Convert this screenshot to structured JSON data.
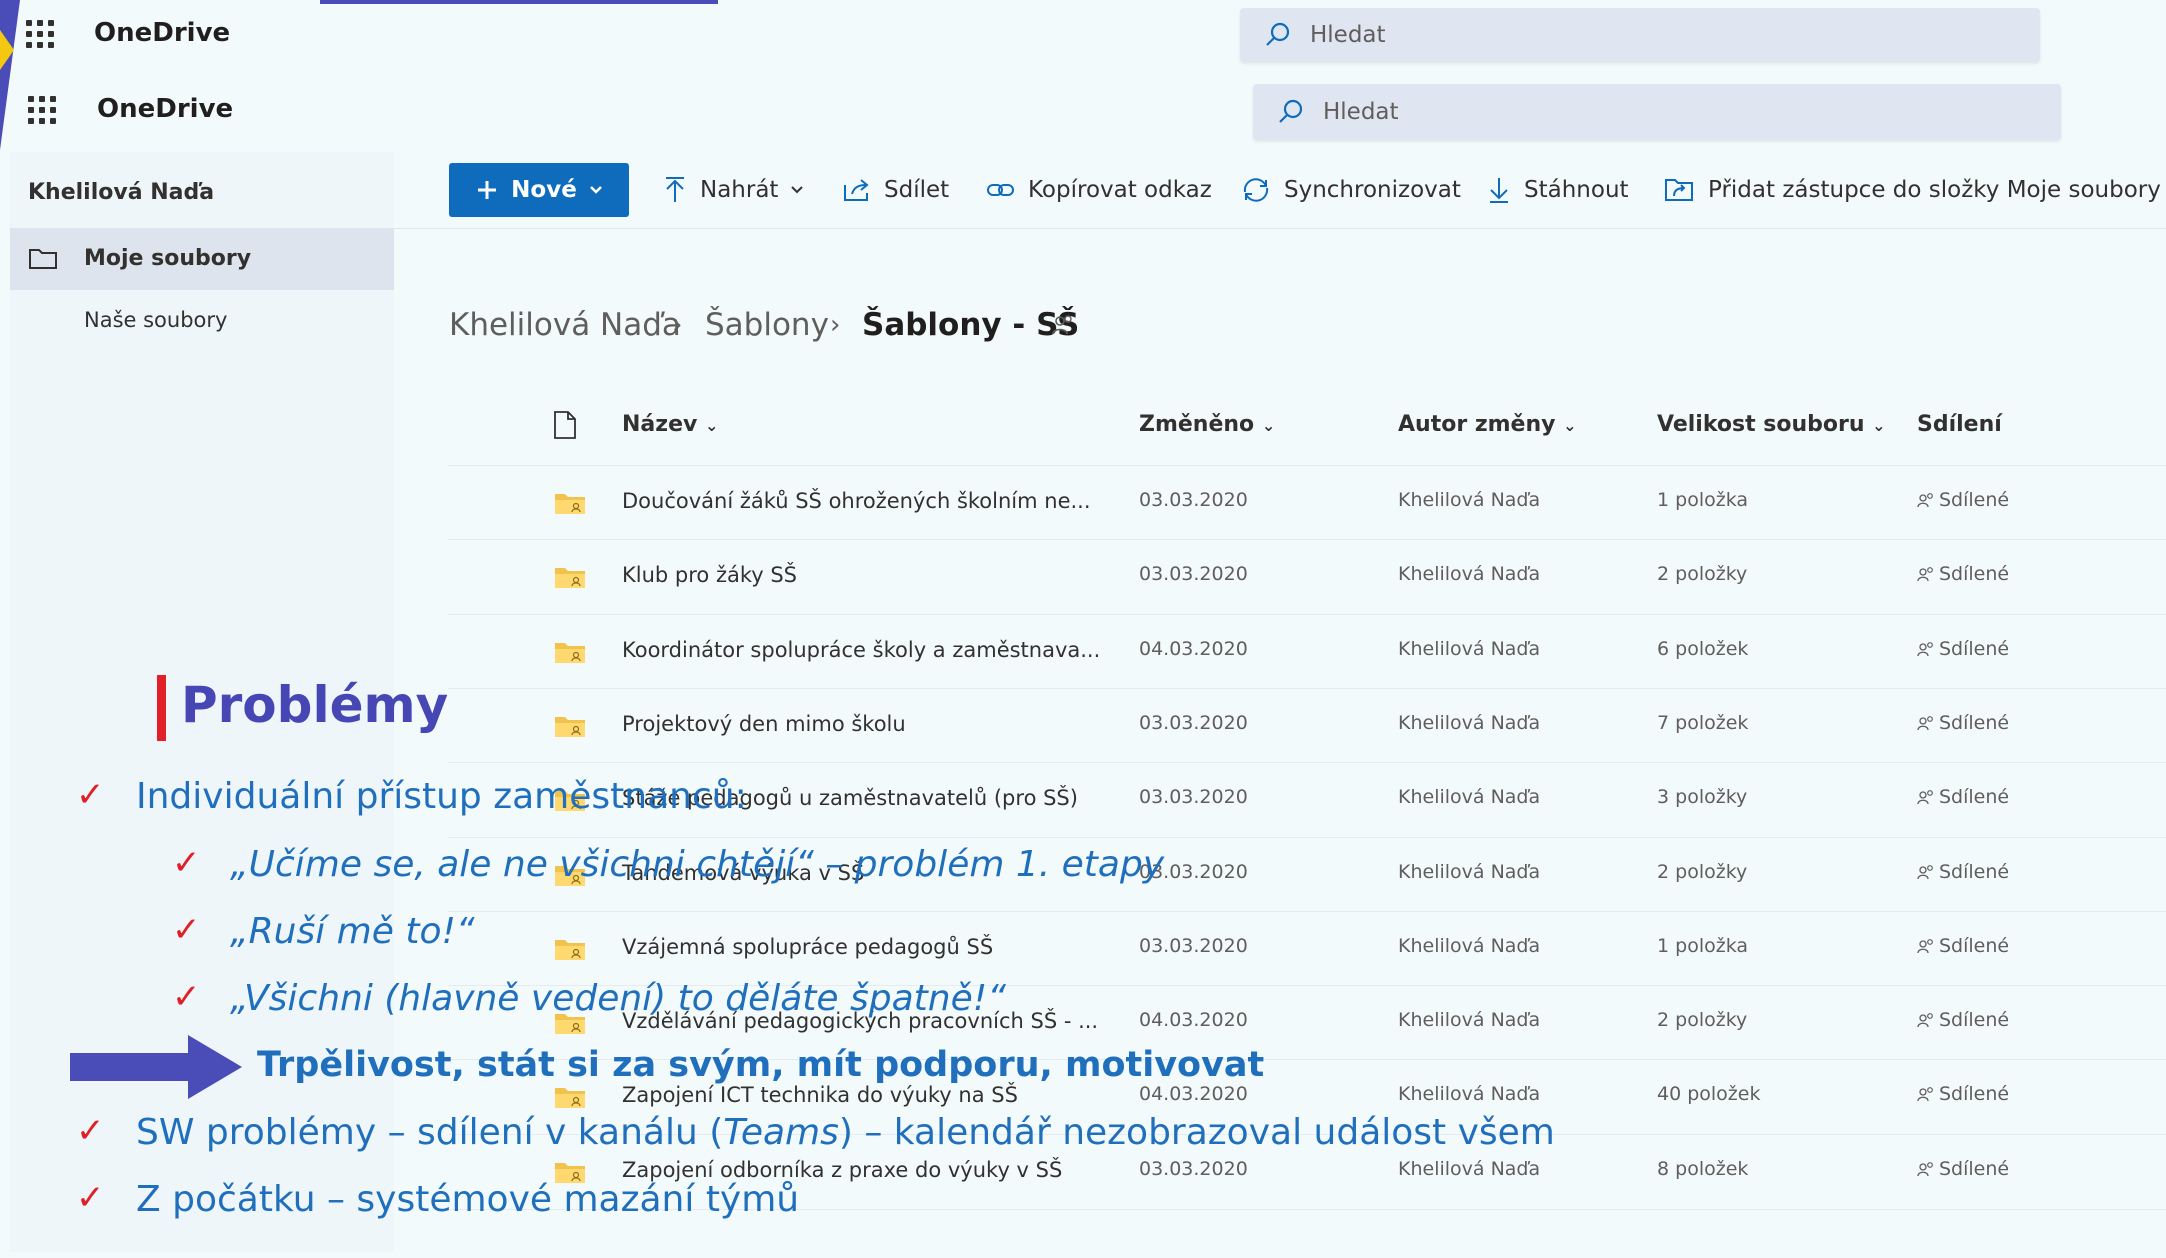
{
  "app": {
    "name": "OneDrive",
    "name_duplicate": "OneDrive"
  },
  "search": {
    "placeholder": "Hledat",
    "placeholder_duplicate": "Hledat"
  },
  "sidebar": {
    "user": "Khelilová Naďa",
    "items": [
      {
        "label": "Moje soubory",
        "icon": "folder-icon",
        "selected": true
      },
      {
        "label": "Naše soubory",
        "selected": false
      }
    ]
  },
  "toolbar": {
    "new_label": "Nové",
    "upload_label": "Nahrát",
    "share_label": "Sdílet",
    "copy_link_label": "Kopírovat odkaz",
    "sync_label": "Synchronizovat",
    "download_label": "Stáhnout",
    "add_shortcut_label": "Přidat zástupce do složky Moje soubory"
  },
  "breadcrumb": [
    "Khelilová Naďa",
    "Šablony",
    "Šablony - SŠ"
  ],
  "table": {
    "headers": {
      "name": "Název",
      "modified": "Změněno",
      "modified_by": "Autor změny",
      "size": "Velikost souboru",
      "sharing": "Sdílení"
    },
    "rows": [
      {
        "name": "Doučování žáků SŠ ohrožených školním ne...",
        "modified": "03.03.2020",
        "author": "Khelilová Naďa",
        "size": "1 položka",
        "sharing": "Sdílené"
      },
      {
        "name": "Klub pro žáky SŠ",
        "modified": "03.03.2020",
        "author": "Khelilová Naďa",
        "size": "2 položky",
        "sharing": "Sdílené"
      },
      {
        "name": "Koordinátor spolupráce školy a zaměstnava...",
        "modified": "04.03.2020",
        "author": "Khelilová Naďa",
        "size": "6 položek",
        "sharing": "Sdílené"
      },
      {
        "name": "Projektový den mimo školu",
        "modified": "03.03.2020",
        "author": "Khelilová Naďa",
        "size": "7 položek",
        "sharing": "Sdílené"
      },
      {
        "name": "Stáže pedagogů u zaměstnavatelů (pro SŠ)",
        "modified": "03.03.2020",
        "author": "Khelilová Naďa",
        "size": "3 položky",
        "sharing": "Sdílené"
      },
      {
        "name": "Tandemová výuka v SŠ",
        "modified": "03.03.2020",
        "author": "Khelilová Naďa",
        "size": "2 položky",
        "sharing": "Sdílené"
      },
      {
        "name": "Vzájemná spolupráce pedagogů SŠ",
        "modified": "03.03.2020",
        "author": "Khelilová Naďa",
        "size": "1 položka",
        "sharing": "Sdílené"
      },
      {
        "name": "Vzdělávání pedagogických pracovních SŠ - ...",
        "modified": "04.03.2020",
        "author": "Khelilová Naďa",
        "size": "2 položky",
        "sharing": "Sdílené"
      },
      {
        "name": "Zapojení ICT technika do výuky na SŠ",
        "modified": "04.03.2020",
        "author": "Khelilová Naďa",
        "size": "40 položek",
        "sharing": "Sdílené"
      },
      {
        "name": "Zapojení odborníka z praxe do výuky v SŠ",
        "modified": "03.03.2020",
        "author": "Khelilová Naďa",
        "size": "8 položek",
        "sharing": "Sdílené"
      }
    ]
  },
  "slide": {
    "title": "Problémy",
    "line1": "Individuální přístup zaměstnanců:",
    "sub1": "„Učíme se, ale ne všichni chtějí“ – problém 1. etapy",
    "sub2": "„Ruší mě to!“",
    "sub3": "„Všichni (hlavně vedení) to děláte špatně!“",
    "emphasis": "Trpělivost, stát si za svým, mít podporu, motivovat",
    "line2_a": "SW problémy – sdílení v kanálu (",
    "line2_b": "Teams",
    "line2_c": ") – kalendář nezobrazoval událost všem",
    "line3": "Z počátku – systémové mazání týmů",
    "check_mark": "✓"
  },
  "colors": {
    "accent_blue": "#0f6cbd",
    "slide_title": "#4646b4",
    "slide_text": "#1f6fbd",
    "check_red": "#e01f26",
    "folder_yellow": "#f2c34c"
  }
}
